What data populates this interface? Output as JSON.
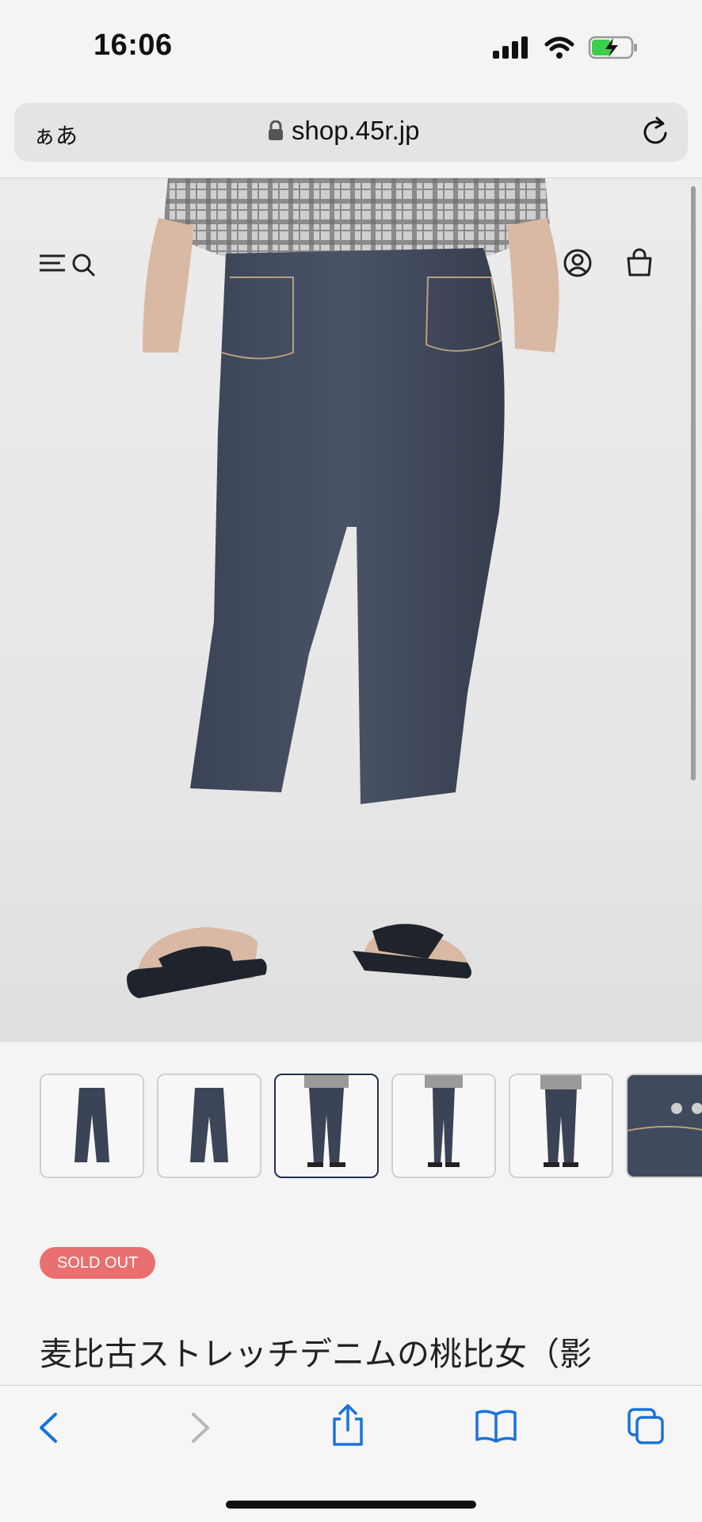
{
  "status_bar": {
    "time": "16:06"
  },
  "browser": {
    "text_size_label": "ぁあ",
    "url": "shop.45r.jp"
  },
  "product": {
    "badge": "SOLD OUT",
    "title": "麦比古ストレッチデニムの桃比女（影"
  },
  "icons": {
    "status": [
      "signal-icon",
      "wifi-icon",
      "battery-charging-icon"
    ],
    "nav": [
      "menu-icon",
      "search-icon",
      "account-icon",
      "cart-icon"
    ],
    "toolbar": [
      "back-icon",
      "forward-icon",
      "share-icon",
      "bookmarks-icon",
      "tabs-icon"
    ]
  },
  "colors": {
    "accent": "#1a73d9",
    "badge": "#ea6f6f",
    "denim": "#3a4254"
  }
}
